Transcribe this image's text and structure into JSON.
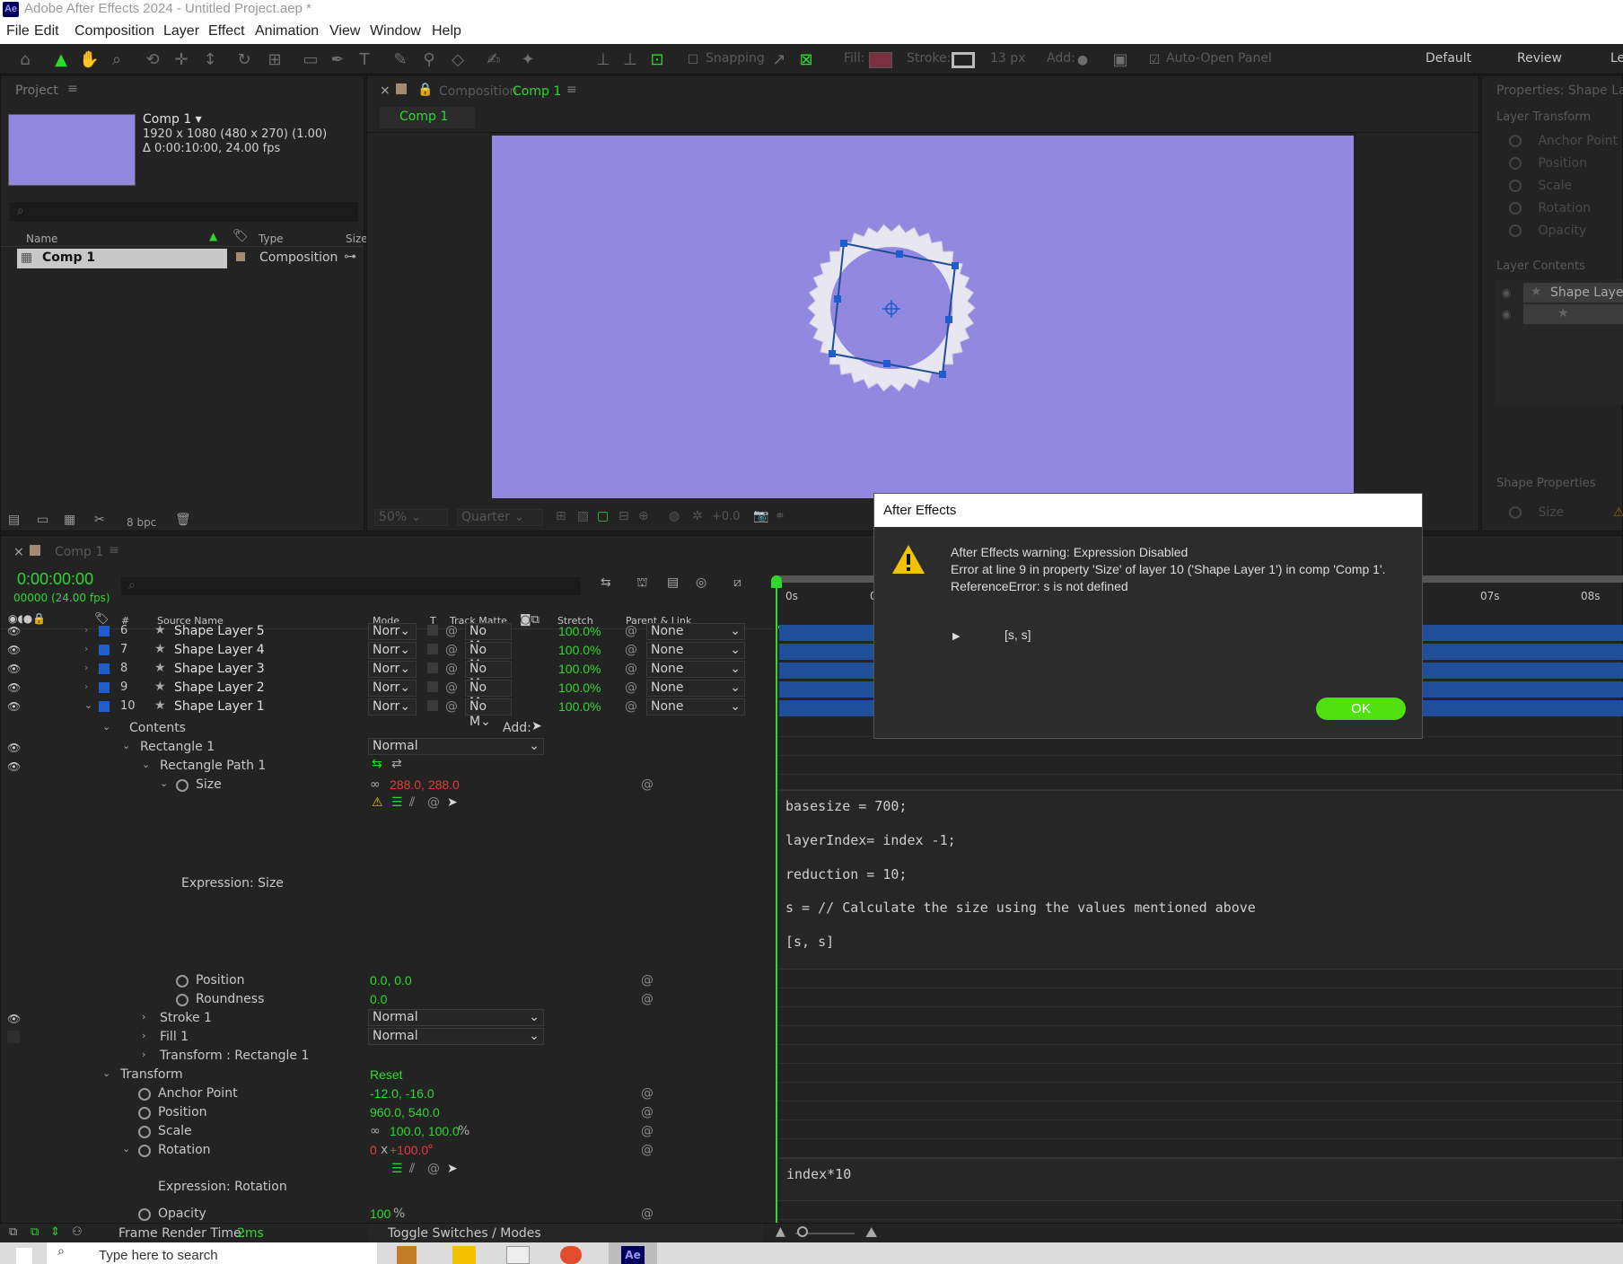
{
  "window": {
    "title": "Adobe After Effects 2024 - Untitled Project.aep *",
    "logo": "Ae"
  },
  "menu": [
    "File",
    "Edit",
    "Composition",
    "Layer",
    "Effect",
    "Animation",
    "View",
    "Window",
    "Help"
  ],
  "toolbar": {
    "snapping": "Snapping",
    "fill": "Fill:",
    "stroke": "Stroke:",
    "stroke_px": "13 px",
    "add": "Add:",
    "auto_open": "Auto-Open Panel",
    "workspaces": [
      "Default",
      "Review",
      "Le"
    ]
  },
  "project": {
    "title": "Project",
    "comp_name": "Comp 1 ▾",
    "comp_info1": "1920 x 1080  (480 x 270) (1.00)",
    "comp_info2": "Δ 0:00:10:00, 24.00 fps",
    "cols": {
      "name": "Name",
      "type": "Type",
      "size": "Size"
    },
    "item": {
      "name": "Comp 1",
      "type": "Composition"
    },
    "bpc": "8 bpc"
  },
  "comp_viewer": {
    "title_prefix": "Composition",
    "title_comp": "Comp 1",
    "tab": "Comp 1",
    "zoom": "50%",
    "resolution": "Quarter",
    "exposure": "+0.0",
    "bg_color": "#9288e0"
  },
  "properties": {
    "title": "Properties: Shape Laye",
    "layer_transform": "Layer Transform",
    "items": [
      "Anchor Point",
      "Position",
      "Scale",
      "Rotation",
      "Opacity"
    ],
    "layer_contents": "Layer Contents",
    "shape_layer": "Shape Layer",
    "shape_properties": "Shape Properties",
    "size": "Size"
  },
  "timeline": {
    "tab": "Comp 1",
    "timecode": "0:00:00:00",
    "frames": "00000 (24.00 fps)",
    "cols": {
      "num": "#",
      "source": "Source Name",
      "mode": "Mode",
      "t": "T",
      "track": "Track Matte",
      "stretch": "Stretch",
      "parent": "Parent & Link"
    },
    "ruler": [
      "0s",
      "0",
      "07s",
      "08s"
    ],
    "layers": [
      {
        "num": "6",
        "name": "Shape Layer 5",
        "mode": "Norr",
        "matte": "No M",
        "stretch": "100.0%",
        "parent": "None"
      },
      {
        "num": "7",
        "name": "Shape Layer 4",
        "mode": "Norr",
        "matte": "No M",
        "stretch": "100.0%",
        "parent": "None"
      },
      {
        "num": "8",
        "name": "Shape Layer 3",
        "mode": "Norr",
        "matte": "No M",
        "stretch": "100.0%",
        "parent": "None"
      },
      {
        "num": "9",
        "name": "Shape Layer 2",
        "mode": "Norr",
        "matte": "No M",
        "stretch": "100.0%",
        "parent": "None"
      },
      {
        "num": "10",
        "name": "Shape Layer 1",
        "mode": "Norr",
        "matte": "No M",
        "stretch": "100.0%",
        "parent": "None"
      }
    ],
    "contents": "Contents",
    "add": "Add:",
    "rect1": "Rectangle 1",
    "rect1_mode": "Normal",
    "rect_path": "Rectangle Path 1",
    "size_label": "Size",
    "size_val": "288.0, 288.0",
    "expr_size": "Expression: Size",
    "position_label": "Position",
    "position_val": "0.0, 0.0",
    "roundness_label": "Roundness",
    "roundness_val": "0.0",
    "stroke1": "Stroke 1",
    "stroke1_mode": "Normal",
    "fill1": "Fill 1",
    "fill1_mode": "Normal",
    "transform_rect": "Transform : Rectangle 1",
    "transform": "Transform",
    "reset": "Reset",
    "anchor_label": "Anchor Point",
    "anchor_val": "-12.0, -16.0",
    "pos_label": "Position",
    "pos_val": "960.0, 540.0",
    "scale_label": "Scale",
    "scale_val": "100.0, 100.0",
    "scale_unit": "%",
    "rot_label": "Rotation",
    "rot_val_a": "0",
    "rot_val_b": "x",
    "rot_val_c": "+100.0",
    "rot_unit": "°",
    "expr_rot": "Expression: Rotation",
    "opacity_label": "Opacity",
    "opacity_val": "100",
    "opacity_unit": "%",
    "code_size": [
      "basesize = 700;",
      "layerIndex= index -1;",
      "reduction = 10;",
      "s = // Calculate the size using the values mentioned above",
      "[s, s]"
    ],
    "code_rot": "index*10",
    "frame_render_label": "Frame Render Time:",
    "frame_render_val": "2ms",
    "toggle": "Toggle Switches / Modes"
  },
  "dialog": {
    "title": "After Effects",
    "line1": "After Effects warning: Expression Disabled",
    "line2": "Error at line 9 in property 'Size' of layer 10 ('Shape Layer 1') in comp 'Comp 1'.",
    "line3": "ReferenceError: s is not defined",
    "detail": "[s, s]",
    "ok": "OK"
  },
  "taskbar": {
    "search_placeholder": "Type here to search"
  }
}
